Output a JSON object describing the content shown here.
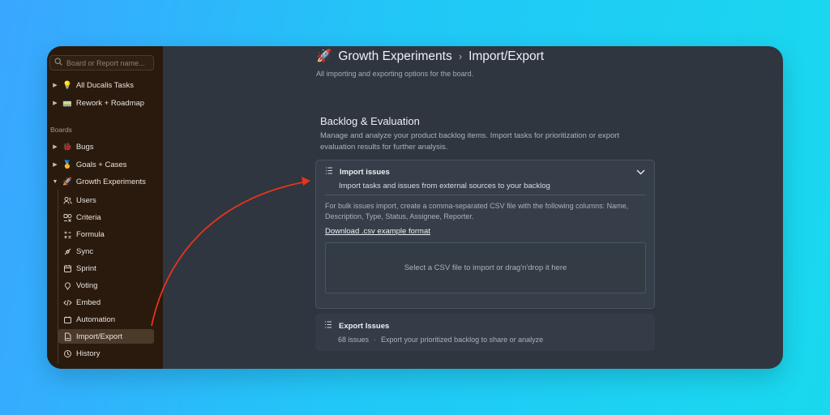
{
  "sidebar": {
    "search_placeholder": "Board or Report name...",
    "pinned": [
      {
        "emoji": "💡",
        "label": "All Ducalis Tasks"
      },
      {
        "emoji": "🚃",
        "label": "Rework + Roadmap"
      }
    ],
    "boards_label": "Boards",
    "boards": [
      {
        "emoji": "🐞",
        "label": "Bugs"
      },
      {
        "emoji": "🥇",
        "label": "Goals + Cases"
      },
      {
        "emoji": "🚀",
        "label": "Growth Experiments"
      }
    ],
    "subitems": [
      {
        "icon": "users-icon",
        "label": "Users"
      },
      {
        "icon": "criteria-icon",
        "label": "Criteria"
      },
      {
        "icon": "formula-icon",
        "label": "Formula"
      },
      {
        "icon": "sync-icon",
        "label": "Sync"
      },
      {
        "icon": "calendar-icon",
        "label": "Sprint"
      },
      {
        "icon": "voting-icon",
        "label": "Voting"
      },
      {
        "icon": "code-icon",
        "label": "Embed"
      },
      {
        "icon": "automation-icon",
        "label": "Automation"
      },
      {
        "icon": "csv-file-icon",
        "label": "Import/Export"
      },
      {
        "icon": "history-icon",
        "label": "History"
      }
    ]
  },
  "header": {
    "emoji": "🚀",
    "board": "Growth Experiments",
    "page": "Import/Export",
    "subtitle": "All importing and exporting options for the board."
  },
  "section": {
    "title": "Backlog & Evaluation",
    "description": "Manage and analyze your product backlog items. Import tasks for prioritization or export evaluation results for further analysis."
  },
  "import_card": {
    "title": "Import issues",
    "subtitle": "Import tasks and issues from external sources to your backlog",
    "body": "For bulk issues import, create a comma-separated CSV file with the following columns: Name, Description, Type, Status, Assignee, Reporter.",
    "link": "Download .csv example format",
    "dropzone": "Select a CSV file to import or drag'n'drop it here"
  },
  "export_card": {
    "title": "Export Issues",
    "count": "68 issues",
    "separator": "·",
    "description": "Export your prioritized backlog to share or analyze"
  },
  "colors": {
    "sidebar_bg": "#2a1a0e",
    "main_bg": "#2f3640",
    "arrow": "#e8341c"
  }
}
